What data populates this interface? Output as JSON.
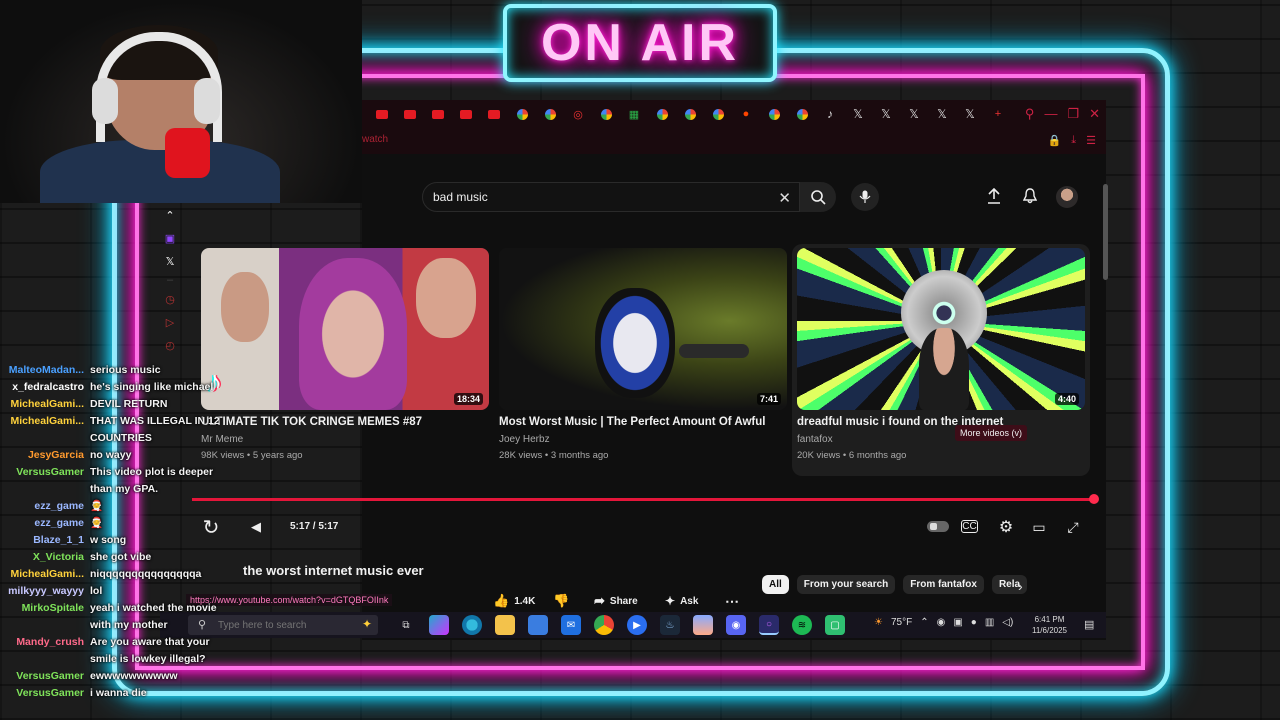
{
  "overlay": {
    "on_air": "ON AIR"
  },
  "browser": {
    "address_fragment": "watch",
    "search_query": "bad music",
    "url_status": "https://www.youtube.com/watch?v=dGTQBFOIInk"
  },
  "videos": [
    {
      "title": "ULTIMATE TIK TOK CRINGE MEMES #87",
      "channel": "Mr Meme",
      "meta": "98K views • 5 years ago",
      "duration": "18:34"
    },
    {
      "title": "Most Worst Music | The Perfect Amount Of Awful",
      "channel": "Joey Herbz",
      "meta": "28K views • 3 months ago",
      "duration": "7:41"
    },
    {
      "title": "dreadful music i found on the internet",
      "channel": "fantafox",
      "meta": "20K views • 6 months ago",
      "duration": "4:40"
    }
  ],
  "tooltip": "More videos (v)",
  "player": {
    "time": "5:17 / 5:17",
    "progress": 1.0
  },
  "video": {
    "title": "the worst internet music ever",
    "likes": "1.4K",
    "share": "Share",
    "ask": "Ask"
  },
  "chips": [
    "All",
    "From your search",
    "From fantafox",
    "Rela"
  ],
  "taskbar": {
    "search_placeholder": "Type here to search",
    "weather": "75°F",
    "time": "6:41 PM",
    "date": "11/6/2025"
  },
  "chat": [
    {
      "user": "MalteoMadan...",
      "color": "#4aa0ff",
      "text": "serious music"
    },
    {
      "user": "x_fedralcastro",
      "color": "#ffffff",
      "text": "he's singing like michael"
    },
    {
      "user": "MichealGami...",
      "color": "#ffd23c",
      "text": "DEVIL RETURN"
    },
    {
      "user": "MichealGami...",
      "color": "#ffd23c",
      "text": "THAT WAS ILLEGAL IN 12 COUNTRIES"
    },
    {
      "user": "JesyGarcia",
      "color": "#ff9a2e",
      "text": "no wayy"
    },
    {
      "user": "VersusGamer",
      "color": "#7fe35a",
      "text": "This video plot is deeper than my GPA."
    },
    {
      "user": "ezz_game",
      "color": "#9bb8ff",
      "text": "🧑‍🎄"
    },
    {
      "user": "ezz_game",
      "color": "#9bb8ff",
      "text": "🧑‍🎄"
    },
    {
      "user": "Blaze_1_1",
      "color": "#9bb8ff",
      "text": "w song"
    },
    {
      "user": "X_Victoria",
      "color": "#7fe35a",
      "text": "she got vibe"
    },
    {
      "user": "MichealGami...",
      "color": "#ffd23c",
      "text": "niqqqqqqqqqqqqqqqa"
    },
    {
      "user": "milkyyy_wayyy",
      "color": "#c8c8ff",
      "text": "lol"
    },
    {
      "user": "MirkoSpitale",
      "color": "#7fe35a",
      "text": "yeah i watched the movie with my mother"
    },
    {
      "user": "Mandy_crush",
      "color": "#ff6a8a",
      "text": "Are you aware that your smile is lowkey illegal?"
    },
    {
      "user": "VersusGamer",
      "color": "#7fe35a",
      "text": "ewwwwwwwwww"
    },
    {
      "user": "VersusGamer",
      "color": "#7fe35a",
      "text": "i wanna die"
    }
  ]
}
